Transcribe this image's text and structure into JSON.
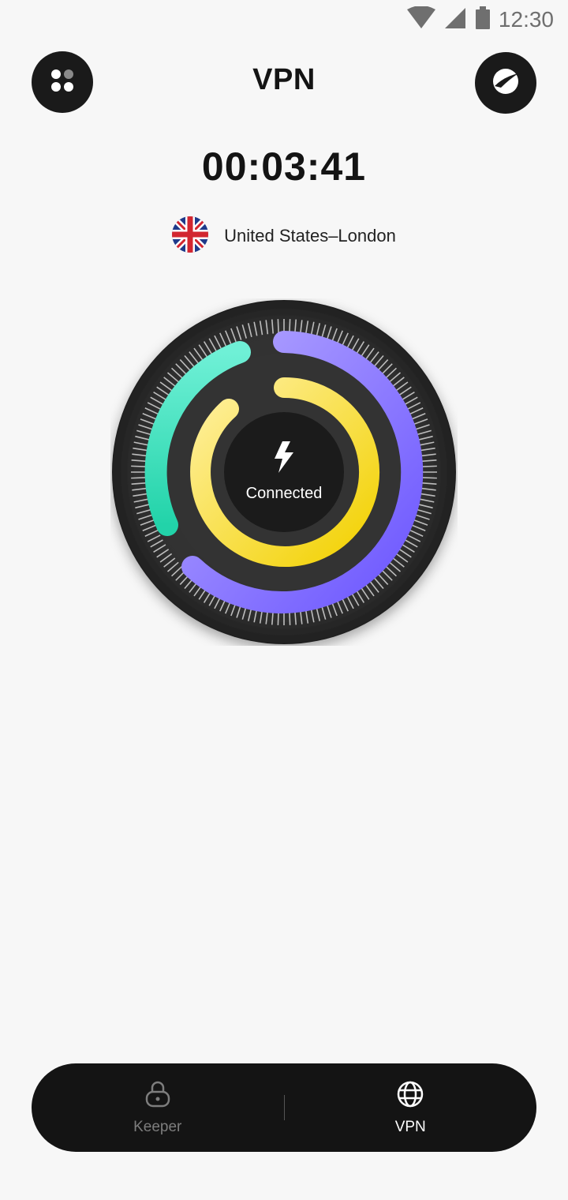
{
  "status_bar": {
    "time": "12:30",
    "icons": [
      "wifi-icon",
      "signal-icon",
      "battery-icon"
    ]
  },
  "header": {
    "title": "VPN",
    "left_button_icon": "apps-grid-icon",
    "right_button_icon": "speed-icon"
  },
  "connection": {
    "timer": "00:03:41",
    "location": "United States–London",
    "flag_icon": "uk-flag-icon",
    "status": "Connected",
    "status_icon": "lightning-bolt-icon"
  },
  "dial": {
    "colors": {
      "outer_ring": "#2b2b2b",
      "inner_ring": "#333333",
      "cyan_arc": "#3be3c0",
      "purple_arc": "#7f6bff",
      "yellow_arc": "#f5d90a",
      "center": "#1b1b1b"
    }
  },
  "bottom_nav": {
    "items": [
      {
        "label": "Keeper",
        "icon": "lock-icon",
        "active": false
      },
      {
        "label": "VPN",
        "icon": "globe-icon",
        "active": true
      }
    ]
  }
}
